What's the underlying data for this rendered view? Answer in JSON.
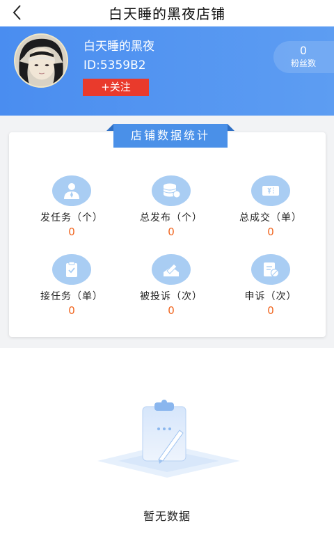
{
  "nav": {
    "title": "白天睡的黑夜店铺"
  },
  "profile": {
    "name": "白天睡的黑夜",
    "id_text": "ID:5359B2",
    "follow_label": "+关注",
    "fans_count": "0",
    "fans_label": "粉丝数"
  },
  "stats": {
    "section_title": "店铺数据统计",
    "items": [
      {
        "icon": "user-suit-icon",
        "label": "发任务（个）",
        "value": "0"
      },
      {
        "icon": "coin-stack-icon",
        "label": "总发布（个）",
        "value": "0"
      },
      {
        "icon": "ticket-icon",
        "label": "总成交（单）",
        "value": "0"
      },
      {
        "icon": "clipboard-check-icon",
        "label": "接任务（单）",
        "value": "0"
      },
      {
        "icon": "complaint-icon",
        "label": "被投诉（次）",
        "value": "0"
      },
      {
        "icon": "appeal-document-icon",
        "label": "申诉（次）",
        "value": "0"
      }
    ]
  },
  "empty": {
    "text": "暂无数据"
  },
  "colors": {
    "primary": "#4a8df0",
    "follow": "#e93a2c",
    "value": "#f0641e",
    "icon_bg": "#a9cdf3"
  }
}
